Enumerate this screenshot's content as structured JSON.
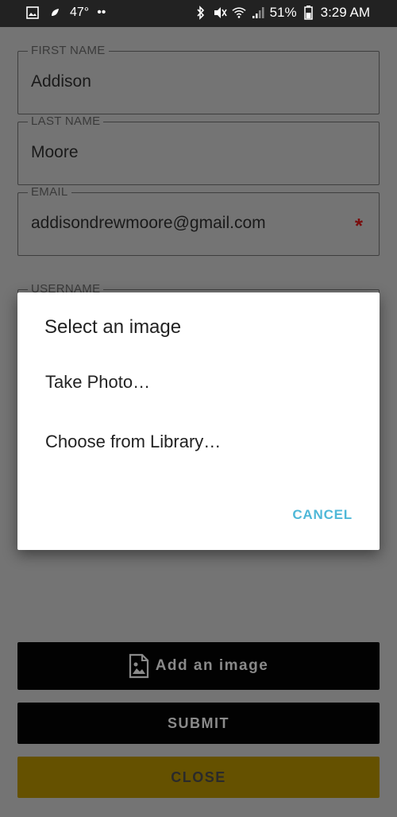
{
  "status_bar": {
    "temperature": "47°",
    "dots": "••",
    "battery_percent": "51%",
    "time": "3:29 AM",
    "icons": [
      "image-icon",
      "leaf-icon",
      "bluetooth-icon",
      "mute-icon",
      "wifi-icon",
      "signal-icon",
      "battery-icon"
    ]
  },
  "form": {
    "first_name": {
      "label": "FIRST NAME",
      "value": "Addison"
    },
    "last_name": {
      "label": "LAST NAME",
      "value": "Moore"
    },
    "email": {
      "label": "EMAIL",
      "value": "addisondrewmoore@gmail.com",
      "required_mark": "*"
    },
    "username": {
      "label": "USERNAME"
    }
  },
  "buttons": {
    "add_image": "Add an image",
    "submit": "SUBMIT",
    "close": "CLOSE"
  },
  "dialog": {
    "title": "Select an image",
    "options": [
      "Take Photo…",
      "Choose from Library…"
    ],
    "cancel": "CANCEL"
  },
  "colors": {
    "accent_cancel": "#4fb8d8",
    "close_button": "#655100",
    "required_star": "#7a0d0d"
  }
}
